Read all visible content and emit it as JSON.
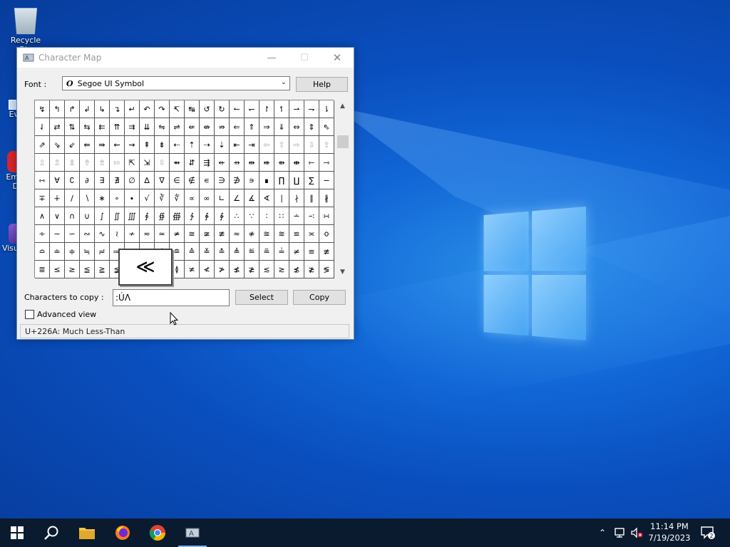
{
  "desktop": {
    "icons": [
      {
        "label": "Recycle Bin"
      },
      {
        "label": "Ev"
      },
      {
        "label": "Em D"
      },
      {
        "label": "Visu"
      }
    ]
  },
  "window": {
    "title": "Character Map",
    "font_label": "Font :",
    "font_value": "Segoe UI Symbol",
    "help_label": "Help",
    "copy_label": "Characters to copy :",
    "copy_value": ":ÚΛ",
    "select_label": "Select",
    "copy_button_label": "Copy",
    "advanced_label": "Advanced view",
    "advanced_checked": false,
    "status_text": "U+226A: Much Less-Than",
    "magnified_char": "≪",
    "grid_rows": [
      [
        "↯",
        "↰",
        "↱",
        "↲",
        "↳",
        "↴",
        "↵",
        "↶",
        "↷",
        "↸",
        "↹",
        "↺",
        "↻",
        "↼",
        "↽",
        "↾",
        "↿",
        "⇀",
        "⇁",
        "⇂"
      ],
      [
        "⇃",
        "⇄",
        "⇅",
        "⇆",
        "⇇",
        "⇈",
        "⇉",
        "⇊",
        "⇋",
        "⇌",
        "⇍",
        "⇎",
        "⇏",
        "⇐",
        "⇑",
        "⇒",
        "⇓",
        "⇔",
        "⇕",
        "⇖"
      ],
      [
        "⇗",
        "⇘",
        "⇙",
        "⇚",
        "⇛",
        "⇜",
        "⇝",
        "⇞",
        "⇟",
        "⇠",
        "⇡",
        "⇢",
        "⇣",
        "⇤",
        "⇥",
        "⇦",
        "⇧",
        "⇨",
        "⇩",
        "⇪"
      ],
      [
        "⇫",
        "⇬",
        "⇭",
        "⇮",
        "⇯",
        "⇰",
        "⇱",
        "⇲",
        "⇳",
        "⇴",
        "⇵",
        "⇶",
        "⇷",
        "⇸",
        "⇹",
        "⇺",
        "⇻",
        "⇼",
        "⇽",
        "⇾"
      ],
      [
        "⇿",
        "∀",
        "∁",
        "∂",
        "∃",
        "∄",
        "∅",
        "∆",
        "∇",
        "∈",
        "∉",
        "∊",
        "∋",
        "∌",
        "∍",
        "∎",
        "∏",
        "∐",
        "∑",
        "−"
      ],
      [
        "∓",
        "∔",
        "∕",
        "∖",
        "∗",
        "∘",
        "∙",
        "√",
        "∛",
        "∜",
        "∝",
        "∞",
        "∟",
        "∠",
        "∡",
        "∢",
        "∣",
        "∤",
        "∥",
        "∦"
      ],
      [
        "∧",
        "∨",
        "∩",
        "∪",
        "∫",
        "∬",
        "∭",
        "∮",
        "∯",
        "∰",
        "∱",
        "∲",
        "∳",
        "∴",
        "∵",
        "∶",
        "∷",
        "∸",
        "∹",
        "∺"
      ],
      [
        "∻",
        "∼",
        "∽",
        "∾",
        "∿",
        "≀",
        "≁",
        "≂",
        "≃",
        "≄",
        "≅",
        "≆",
        "≇",
        "≈",
        "≉",
        "≊",
        "≋",
        "≌",
        "≍",
        "≎"
      ],
      [
        "≏",
        "≐",
        "≑",
        "≒",
        "≓",
        "≔",
        "≕",
        "≖",
        "≗",
        "≘",
        "≙",
        "≚",
        "≛",
        "≜",
        "≝",
        "≞",
        "≟",
        "≠",
        "≡",
        "≢"
      ],
      [
        "≣",
        "≤",
        "≥",
        "≦",
        "≧",
        "≨",
        "≩",
        "≪",
        "≫",
        "≬",
        "≭",
        "≮",
        "≯",
        "≰",
        "≱",
        "≲",
        "≳",
        "≴",
        "≵",
        "≶"
      ]
    ]
  },
  "taskbar": {
    "items": [
      {
        "name": "start-button",
        "icon": "windows-logo-icon"
      },
      {
        "name": "search-button",
        "icon": "search-icon"
      },
      {
        "name": "file-explorer-button",
        "icon": "folder-icon"
      },
      {
        "name": "firefox-button",
        "icon": "firefox-icon"
      },
      {
        "name": "chrome-button",
        "icon": "chrome-icon"
      },
      {
        "name": "charmap-button",
        "icon": "charmap-icon"
      }
    ],
    "time": "11:14 PM",
    "date": "7/19/2023",
    "notification_count": "2"
  }
}
